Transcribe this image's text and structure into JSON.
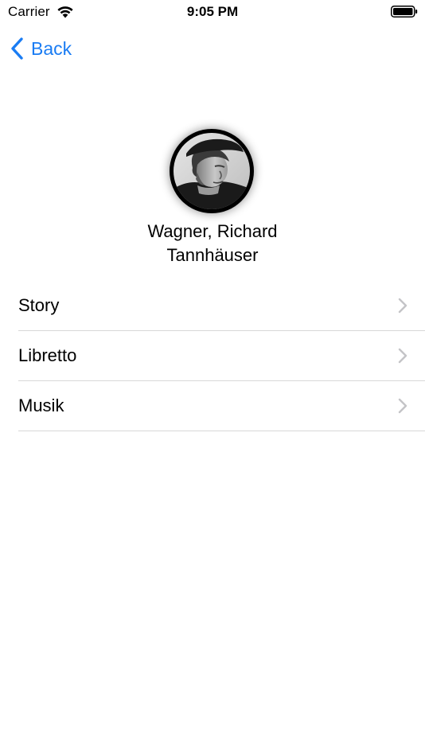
{
  "status_bar": {
    "carrier": "Carrier",
    "time": "9:05 PM",
    "icons": [
      "wifi-icon",
      "battery-icon"
    ]
  },
  "nav": {
    "back_label": "Back",
    "back_icon": "chevron-left-icon"
  },
  "header": {
    "avatar_icon": "composer-portrait",
    "composer": "Wagner, Richard",
    "opera": "Tannhäuser"
  },
  "menu": {
    "items": [
      {
        "label": "Story",
        "icon": "chevron-right-icon"
      },
      {
        "label": "Libretto",
        "icon": "chevron-right-icon"
      },
      {
        "label": "Musik",
        "icon": "chevron-right-icon"
      }
    ]
  },
  "colors": {
    "accent": "#1a7cf3",
    "separator": "#d8d8d8",
    "chevron": "#c4c4c7",
    "background": "#ffffff"
  }
}
